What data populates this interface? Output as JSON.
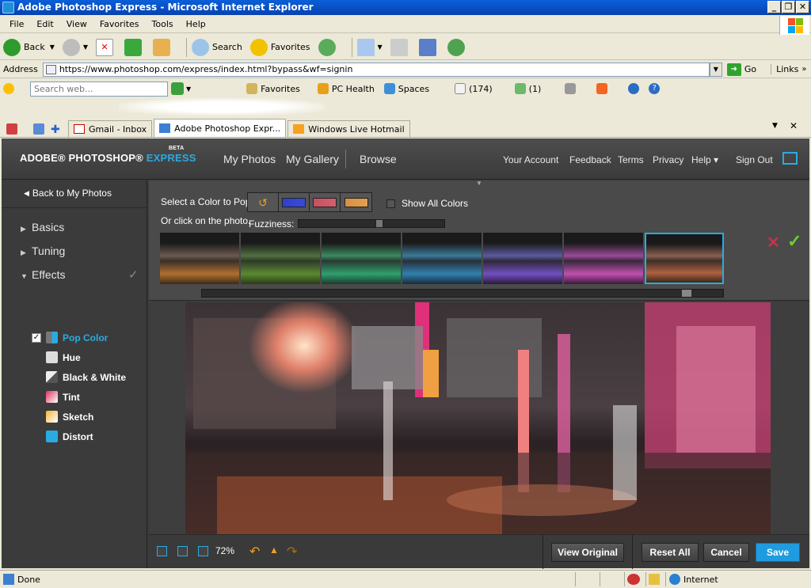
{
  "window": {
    "title": "Adobe Photoshop Express - Microsoft Internet Explorer"
  },
  "menu": [
    "File",
    "Edit",
    "View",
    "Favorites",
    "Tools",
    "Help"
  ],
  "toolbar": {
    "back": "Back",
    "search": "Search",
    "favorites": "Favorites"
  },
  "address": {
    "label": "Address",
    "url": "https://www.photoshop.com/express/index.html?bypass&wf=signin",
    "go": "Go",
    "links": "Links"
  },
  "live_toolbar": {
    "search_placeholder": "Search web...",
    "favorites": "Favorites",
    "pc_health": "PC Health",
    "spaces": "Spaces",
    "mail_count": "(174)",
    "contacts_count": "(1)"
  },
  "tabs": [
    {
      "label": "Gmail - Inbox"
    },
    {
      "label": "Adobe Photoshop Expr..."
    },
    {
      "label": "Windows Live Hotmail"
    }
  ],
  "app": {
    "logo_prefix": "ADOBE® PHOTOSHOP® ",
    "logo_express": "EXPRESS",
    "logo_beta": "BETA",
    "nav": {
      "my_photos": "My Photos",
      "my_gallery": "My Gallery",
      "browse": "Browse"
    },
    "right_nav": {
      "account": "Your Account",
      "feedback": "Feedback",
      "terms": "Terms",
      "privacy": "Privacy",
      "help": "Help ▾",
      "signout": "Sign Out"
    },
    "colors": {
      "accent": "#29abe2",
      "save": "#1f9ce0"
    }
  },
  "sidebar": {
    "back": "Back to My Photos",
    "sections": {
      "basics": "Basics",
      "tuning": "Tuning",
      "effects": "Effects"
    },
    "effects": [
      "Pop Color",
      "Hue",
      "Black & White",
      "Tint",
      "Sketch",
      "Distort"
    ]
  },
  "options": {
    "select_label": "Select a Color to Pop:",
    "click_label": "Or click on the photo.",
    "show_all": "Show All Colors",
    "fuzziness": "Fuzziness:",
    "fuzziness_level": 0.55,
    "swatches": [
      "#2f3fd0",
      "#c85060",
      "#d89040"
    ],
    "selected_thumbnail": 6
  },
  "bottom": {
    "zoom": "72%",
    "view_original": "View Original",
    "reset_all": "Reset All",
    "cancel": "Cancel",
    "save": "Save"
  },
  "status": {
    "left": "Done",
    "zone": "Internet"
  }
}
